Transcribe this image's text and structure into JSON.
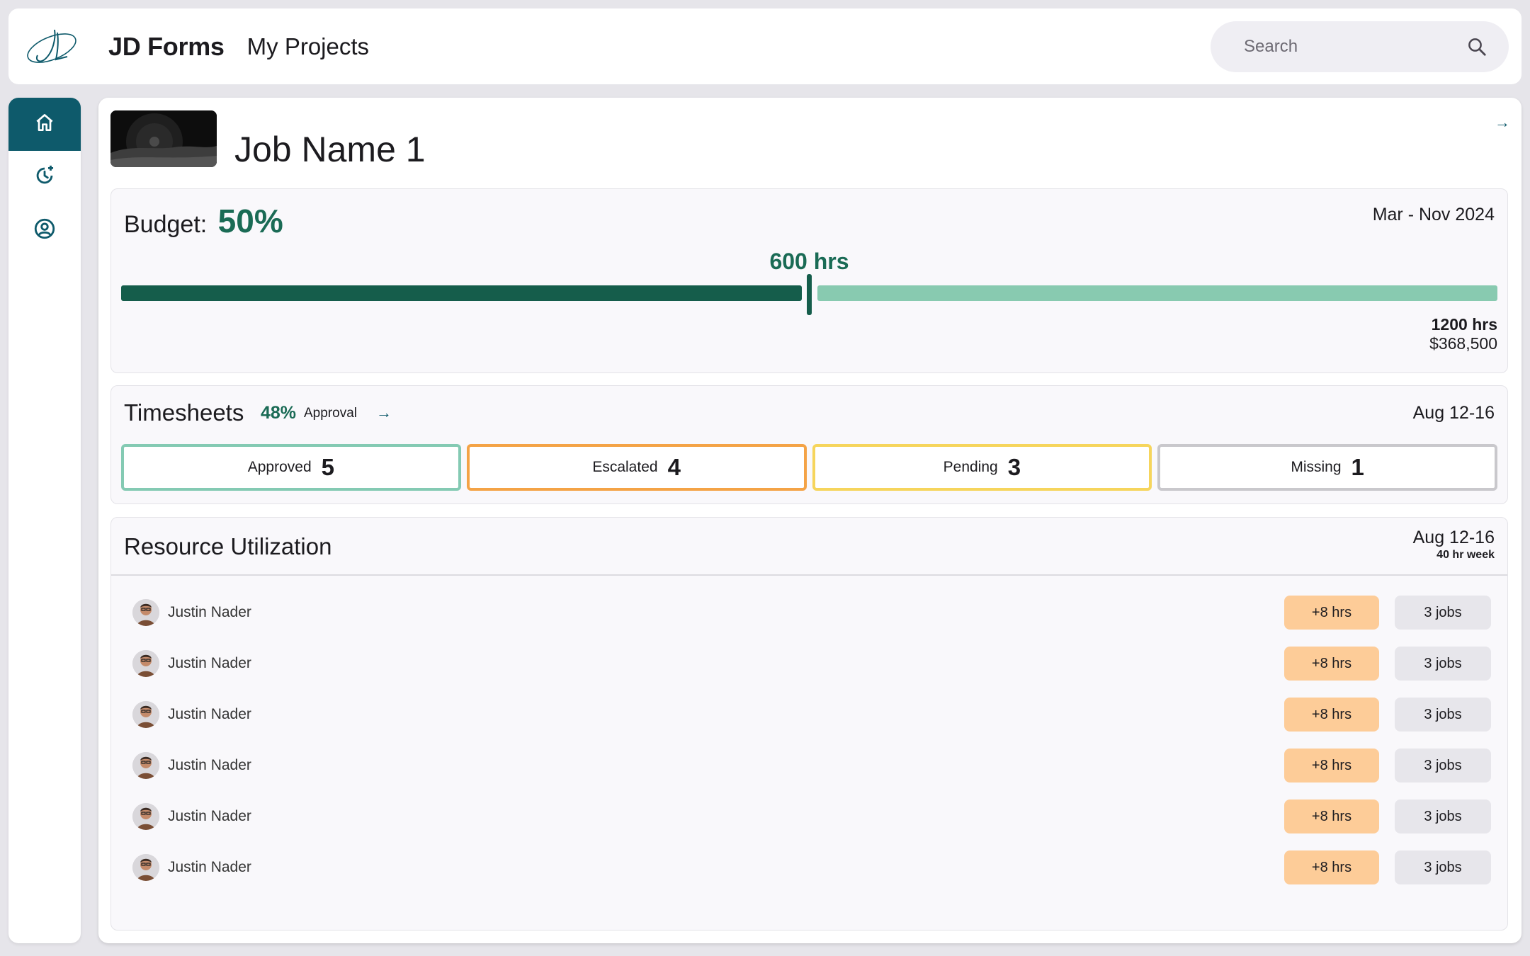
{
  "header": {
    "app_name": "JD Forms",
    "page_name": "My Projects",
    "search_placeholder": "Search"
  },
  "sidebar": {
    "items": [
      {
        "icon": "home-icon",
        "active": true
      },
      {
        "icon": "history-add-icon",
        "active": false
      },
      {
        "icon": "account-circle-icon",
        "active": false
      }
    ]
  },
  "job": {
    "title": "Job Name 1"
  },
  "budget": {
    "label": "Budget:",
    "percent": "50%",
    "percent_value": 0.5,
    "date_range": "Mar - Nov 2024",
    "used_hours": "600 hrs",
    "total_hours": "1200 hrs",
    "total_cost": "$368,500"
  },
  "timesheets": {
    "title": "Timesheets",
    "approval_percent": "48%",
    "approval_label": "Approval",
    "date_range": "Aug 12-16",
    "statuses": [
      {
        "label": "Approved",
        "count": "5",
        "color": "#84cab3"
      },
      {
        "label": "Escalated",
        "count": "4",
        "color": "#f4a346"
      },
      {
        "label": "Pending",
        "count": "3",
        "color": "#f6d55c"
      },
      {
        "label": "Missing",
        "count": "1",
        "color": "#c9c8cc"
      }
    ]
  },
  "resources": {
    "title": "Resource Utilization",
    "date_range": "Aug 12-16",
    "week_note": "40 hr week",
    "rows": [
      {
        "name": "Justin Nader",
        "hours": "+8 hrs",
        "jobs": "3 jobs"
      },
      {
        "name": "Justin Nader",
        "hours": "+8 hrs",
        "jobs": "3 jobs"
      },
      {
        "name": "Justin Nader",
        "hours": "+8 hrs",
        "jobs": "3 jobs"
      },
      {
        "name": "Justin Nader",
        "hours": "+8 hrs",
        "jobs": "3 jobs"
      },
      {
        "name": "Justin Nader",
        "hours": "+8 hrs",
        "jobs": "3 jobs"
      },
      {
        "name": "Justin Nader",
        "hours": "+8 hrs",
        "jobs": "3 jobs"
      }
    ]
  },
  "colors": {
    "brand": "#0e5a6b",
    "budget_used": "#155d4b",
    "budget_remaining": "#88cab0",
    "hours_pill": "#fdcc98",
    "jobs_pill": "#e7e6eb"
  }
}
